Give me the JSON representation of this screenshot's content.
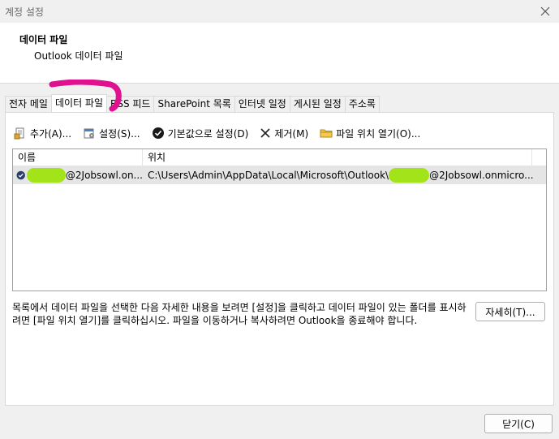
{
  "window": {
    "title": "계정 설정",
    "close_icon": "close-icon"
  },
  "header": {
    "title": "데이터 파일",
    "subtitle": "Outlook 데이터 파일"
  },
  "tabs": [
    {
      "label": "전자 메일",
      "active": false
    },
    {
      "label": "데이터 파일",
      "active": true
    },
    {
      "label": "RSS 피드",
      "active": false
    },
    {
      "label": "SharePoint 목록",
      "active": false
    },
    {
      "label": "인터넷 일정",
      "active": false
    },
    {
      "label": "게시된 일정",
      "active": false
    },
    {
      "label": "주소록",
      "active": false
    }
  ],
  "toolbar": {
    "add_label": "추가(A)...",
    "settings_label": "설정(S)...",
    "default_label": "기본값으로 설정(D)",
    "remove_label": "제거(M)",
    "open_location_label": "파일 위치 열기(O)..."
  },
  "list": {
    "columns": [
      "이름",
      "위치"
    ],
    "rows": [
      {
        "name_suffix": "@2Jobsowl.on...",
        "location_prefix": "C:\\Users\\Admin\\AppData\\Local\\Microsoft\\Outlook\\",
        "location_suffix": "@2Jobsowl.onmicro..."
      }
    ]
  },
  "description": "목록에서 데이터 파일을 선택한 다음 자세한 내용을 보려면 [설정]을 클릭하고 데이터 파일이 있는 폴더를 표시하려면 [파일 위치 열기]를 클릭하십시오. 파일을 이동하거나 복사하려면 Outlook을 종료해야 합니다.",
  "buttons": {
    "details_label": "자세히(T)...",
    "close_label": "닫기(C)"
  },
  "colors": {
    "redaction": "#a3e31a",
    "annotation": "#e0118f",
    "selected_row": "#e5e5e5"
  }
}
